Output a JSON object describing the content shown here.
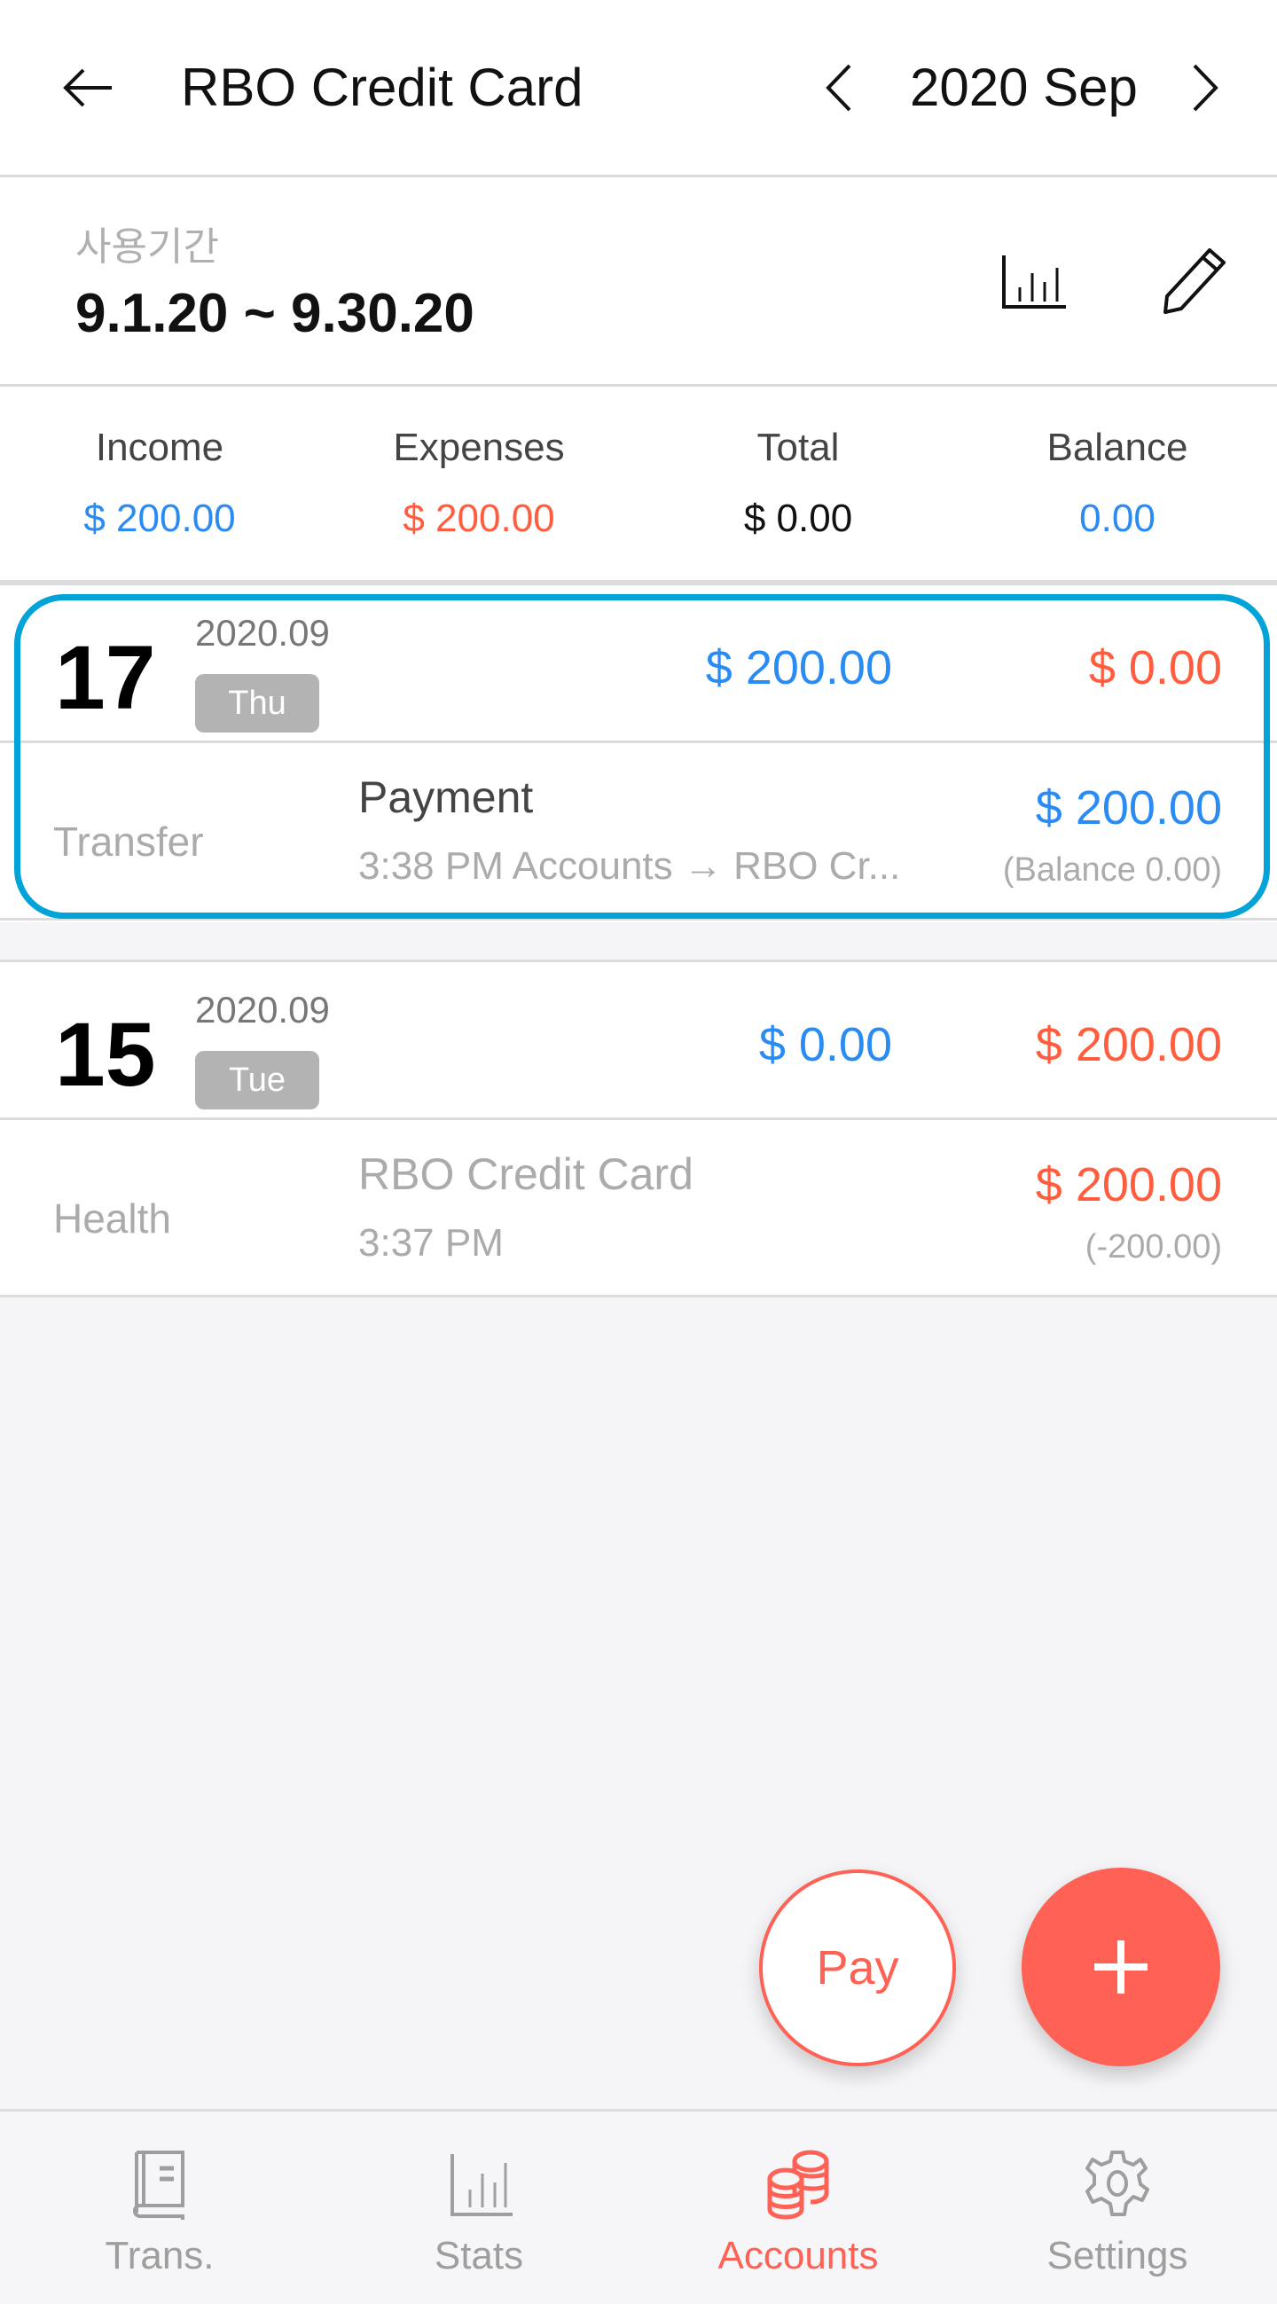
{
  "header": {
    "title": "RBO Credit Card",
    "month": "2020 Sep"
  },
  "period": {
    "label": "사용기간",
    "range": "9.1.20  ~  9.30.20"
  },
  "summary": [
    {
      "label": "Income",
      "value": "$ 200.00",
      "color": "blue"
    },
    {
      "label": "Expenses",
      "value": "$ 200.00",
      "color": "red"
    },
    {
      "label": "Total",
      "value": "$ 0.00",
      "color": "black"
    },
    {
      "label": "Balance",
      "value": "0.00",
      "color": "blue"
    }
  ],
  "days": [
    {
      "day": "17",
      "year_month": "2020.09",
      "weekday": "Thu",
      "income": "$ 200.00",
      "expense": "$ 0.00",
      "highlighted": true,
      "transactions": [
        {
          "category": "Transfer",
          "name": "Payment",
          "subtitle": "3:38 PM   Accounts → RBO Cr...",
          "amount": "$ 200.00",
          "amount_color": "blue",
          "balance": "(Balance  0.00)"
        }
      ]
    },
    {
      "day": "15",
      "year_month": "2020.09",
      "weekday": "Tue",
      "income": "$ 0.00",
      "expense": "$ 200.00",
      "highlighted": false,
      "transactions": [
        {
          "category": "Health",
          "name": "RBO Credit Card",
          "subtitle": "3:37 PM",
          "amount": "$ 200.00",
          "amount_color": "red",
          "balance": "(-200.00)"
        }
      ]
    }
  ],
  "fab": {
    "pay_label": "Pay",
    "add_icon": "plus-icon"
  },
  "nav": {
    "items": [
      {
        "label": "Trans.",
        "icon": "book-icon",
        "active": false
      },
      {
        "label": "Stats",
        "icon": "bar-chart-icon",
        "active": false
      },
      {
        "label": "Accounts",
        "icon": "coins-icon",
        "active": true
      },
      {
        "label": "Settings",
        "icon": "gear-icon",
        "active": false
      }
    ]
  },
  "colors": {
    "income_blue": "#2a8bf2",
    "expense_red": "#ff5d3e",
    "accent": "#ff6154",
    "highlight_border": "#02a3d8"
  }
}
